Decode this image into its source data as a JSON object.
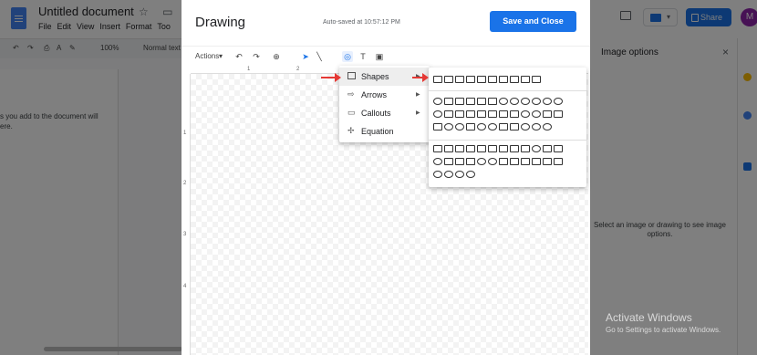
{
  "doc": {
    "title": "Untitled document",
    "menu": [
      "File",
      "Edit",
      "View",
      "Insert",
      "Format",
      "Too"
    ],
    "zoom": "100%",
    "style": "Normal text",
    "body_text_line1": "s you add to the document will",
    "body_text_line2": "ere.",
    "share_label": "Share",
    "avatar_letter": "M"
  },
  "side_panel": {
    "title": "Image options",
    "close": "×",
    "message_line1": "Select an image or drawing to see image",
    "message_line2": "options."
  },
  "drawing": {
    "title": "Drawing",
    "autosaved": "Auto-saved at 10:57:12 PM",
    "save_close": "Save and Close",
    "actions_label": "Actions",
    "ruler_h": [
      "1",
      "2"
    ],
    "ruler_v": [
      "1",
      "2",
      "3",
      "4"
    ]
  },
  "shape_menu": {
    "items": [
      {
        "label": "Shapes",
        "icon": "square-icon"
      },
      {
        "label": "Arrows",
        "icon": "arrow-icon"
      },
      {
        "label": "Callouts",
        "icon": "callout-icon"
      },
      {
        "label": "Equation",
        "icon": "equation-icon"
      }
    ]
  },
  "watermark": {
    "title": "Activate Windows",
    "subtitle": "Go to Settings to activate Windows."
  },
  "colors": {
    "accent": "#1a73e8",
    "arrow_red": "#e53935"
  }
}
